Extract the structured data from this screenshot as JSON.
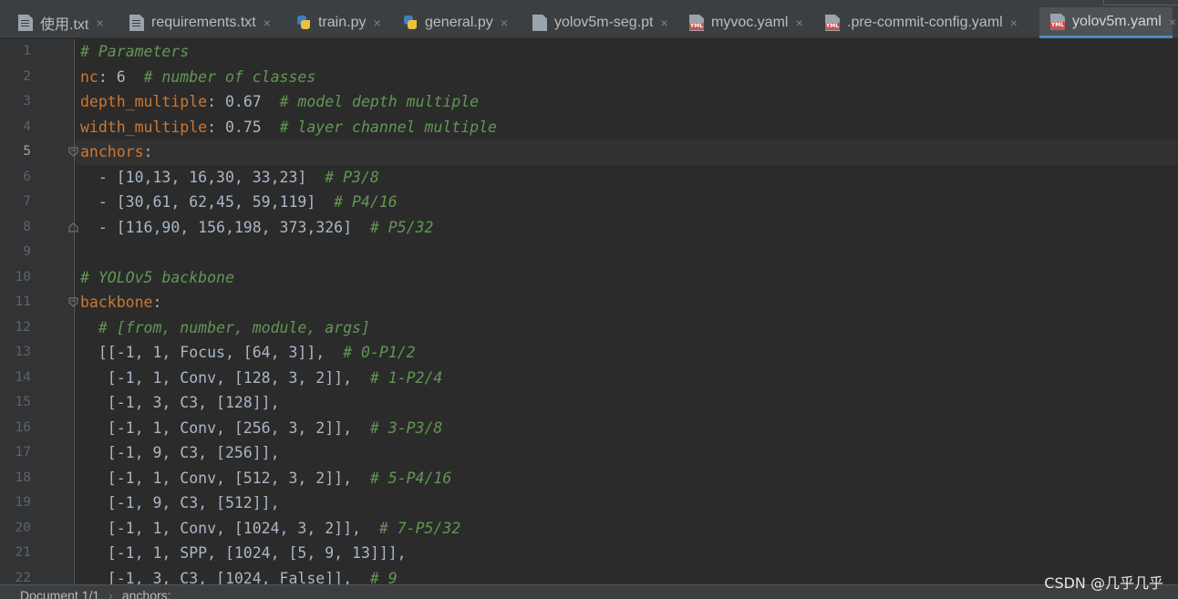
{
  "tabs": [
    {
      "label": "使用.txt",
      "icon": "text-file-icon",
      "active": false
    },
    {
      "label": "requirements.txt",
      "icon": "text-file-icon",
      "active": false
    },
    {
      "label": "train.py",
      "icon": "python-file-icon",
      "active": false
    },
    {
      "label": "general.py",
      "icon": "python-file-icon",
      "active": false
    },
    {
      "label": "yolov5m-seg.pt",
      "icon": "binary-file-icon",
      "active": false
    },
    {
      "label": "myvoc.yaml",
      "icon": "yaml-file-icon",
      "active": false
    },
    {
      "label": ".pre-commit-config.yaml",
      "icon": "yaml-file-icon",
      "active": false
    },
    {
      "label": "yolov5m.yaml",
      "icon": "yaml-file-icon",
      "active": true
    }
  ],
  "tab_close_glyph": "×",
  "yaml_badge": "YML",
  "current_line": 5,
  "lines": [
    [
      {
        "t": "c",
        "v": "# Parameters"
      }
    ],
    [
      {
        "t": "k",
        "v": "nc"
      },
      {
        "t": "n",
        "v": ": 6  "
      },
      {
        "t": "c",
        "v": "# number of classes"
      }
    ],
    [
      {
        "t": "k",
        "v": "depth_multiple"
      },
      {
        "t": "n",
        "v": ": 0.67  "
      },
      {
        "t": "c",
        "v": "# model depth multiple"
      }
    ],
    [
      {
        "t": "k",
        "v": "width_multiple"
      },
      {
        "t": "n",
        "v": ": 0.75  "
      },
      {
        "t": "c",
        "v": "# layer channel multiple"
      }
    ],
    [
      {
        "t": "k",
        "v": "anchors"
      },
      {
        "t": "n",
        "v": ":"
      }
    ],
    [
      {
        "t": "n",
        "v": "  - [10,13, 16,30, 33,23]  "
      },
      {
        "t": "c",
        "v": "# P3/8"
      }
    ],
    [
      {
        "t": "n",
        "v": "  - [30,61, 62,45, 59,119]  "
      },
      {
        "t": "c",
        "v": "# P4/16"
      }
    ],
    [
      {
        "t": "n",
        "v": "  - [116,90, 156,198, 373,326]  "
      },
      {
        "t": "c",
        "v": "# P5/32"
      }
    ],
    [],
    [
      {
        "t": "c",
        "v": "# YOLOv5 backbone"
      }
    ],
    [
      {
        "t": "k",
        "v": "backbone"
      },
      {
        "t": "n",
        "v": ":"
      }
    ],
    [
      {
        "t": "c",
        "v": "  # [from, number, module, args]"
      }
    ],
    [
      {
        "t": "n",
        "v": "  [[-1, 1, Focus, [64, 3]],  "
      },
      {
        "t": "c",
        "v": "# 0-P1/2"
      }
    ],
    [
      {
        "t": "n",
        "v": "   [-1, 1, Conv, [128, 3, 2]],  "
      },
      {
        "t": "c",
        "v": "# 1-P2/4"
      }
    ],
    [
      {
        "t": "n",
        "v": "   [-1, 3, C3, [128]],"
      }
    ],
    [
      {
        "t": "n",
        "v": "   [-1, 1, Conv, [256, 3, 2]],  "
      },
      {
        "t": "c",
        "v": "# 3-P3/8"
      }
    ],
    [
      {
        "t": "n",
        "v": "   [-1, 9, C3, [256]],"
      }
    ],
    [
      {
        "t": "n",
        "v": "   [-1, 1, Conv, [512, 3, 2]],  "
      },
      {
        "t": "c",
        "v": "# 5-P4/16"
      }
    ],
    [
      {
        "t": "n",
        "v": "   [-1, 9, C3, [512]],"
      }
    ],
    [
      {
        "t": "n",
        "v": "   [-1, 1, Conv, [1024, 3, 2]],  "
      },
      {
        "t": "c",
        "v": "# 7-P5/32"
      }
    ],
    [
      {
        "t": "n",
        "v": "   [-1, 1, SPP, [1024, [5, 9, 13]]],"
      }
    ],
    [
      {
        "t": "n",
        "v": "   [-1, 3, C3, [1024, False]],  "
      },
      {
        "t": "c",
        "v": "# 9"
      }
    ]
  ],
  "fold_lines": [
    {
      "line": 5,
      "kind": "open"
    },
    {
      "line": 8,
      "kind": "close"
    },
    {
      "line": 11,
      "kind": "open"
    }
  ],
  "statusbar": {
    "document": "Document 1/1",
    "separator": "›",
    "path": "anchors:"
  },
  "watermark": "CSDN @几乎几乎",
  "colors": {
    "keyword": "#cc7832",
    "comment": "#629755",
    "text": "#a9b7c6",
    "background": "#2b2b2b",
    "active_tab_underline": "#4a88c7"
  }
}
